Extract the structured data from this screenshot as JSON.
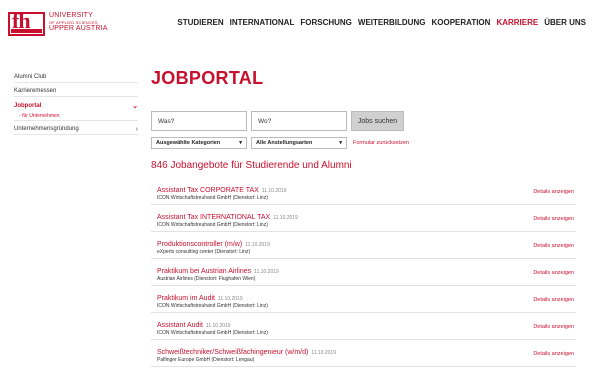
{
  "logo": {
    "line1": "UNIVERSITY",
    "line2": "OF APPLIED SCIENCES",
    "line3": "UPPER AUSTRIA",
    "mark": "fh",
    "brand_color": "#c8102e"
  },
  "nav": {
    "items": [
      "STUDIEREN",
      "INTERNATIONAL",
      "FORSCHUNG",
      "WEITERBILDUNG",
      "KOOPERATION",
      "KARRIERE",
      "ÜBER UNS"
    ],
    "active_index": 5
  },
  "sidebar": {
    "items": [
      {
        "label": "Alumni Club"
      },
      {
        "label": "Karrieremessen"
      },
      {
        "label": "Jobportal",
        "sub": "für Unternehmen"
      },
      {
        "label": "Unternehmensgründung"
      }
    ]
  },
  "main": {
    "title": "JOBPORTAL",
    "search": {
      "what_placeholder": "Was?",
      "where_placeholder": "Wo?",
      "button": "Jobs suchen"
    },
    "filters": {
      "category": "Ausgewählte Kategorien",
      "employment": "Alle Anstellungsarten",
      "reset": "Formular zurücksetzen"
    },
    "count_text": "846 Jobangebote für Studierende und Alumni",
    "details_label": "Details anzeigen",
    "jobs": [
      {
        "title": "Assistant Tax CORPORATE TAX",
        "date": "11.10.2019",
        "company": "ICON Wirtschaftstreuhand GmbH (Dienstort: Linz)"
      },
      {
        "title": "Assistant Tax INTERNATIONAL TAX",
        "date": "11.10.2019",
        "company": "ICON Wirtschaftstreuhand GmbH (Dienstort: Linz)"
      },
      {
        "title": "Produktionscontroller (m/w)",
        "date": "11.10.2019",
        "company": "eXperts consulting center (Dienstort: Linz)"
      },
      {
        "title": "Praktikum bei Austrian Airlines",
        "date": "11.10.2019",
        "company": "Austrian Airlines (Dienstort: Flughafen Wien)"
      },
      {
        "title": "Praktikum im Audit",
        "date": "11.10.2019",
        "company": "ICON Wirtschaftstreuhand GmbH (Dienstort: Linz)"
      },
      {
        "title": "Assistant Audit",
        "date": "11.10.2019",
        "company": "ICON Wirtschaftstreuhand GmbH (Dienstort: Linz)"
      },
      {
        "title": "Schweißtechniker/Schweißfachingenieur (w/m/d)",
        "date": "11.10.2019",
        "company": "Palfinger Europe GmbH (Dienstort: Lengau)"
      }
    ]
  }
}
